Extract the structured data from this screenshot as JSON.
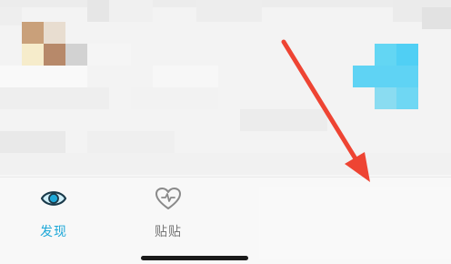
{
  "colors": {
    "accent": "#1ea8d8",
    "annotation_arrow": "#ee4433",
    "inactive": "#777777"
  },
  "tabbar": {
    "tabs": [
      {
        "label": "发现",
        "icon": "eye-icon",
        "active": true
      },
      {
        "label": "贴贴",
        "icon": "heart-pulse-icon",
        "active": false
      }
    ]
  }
}
